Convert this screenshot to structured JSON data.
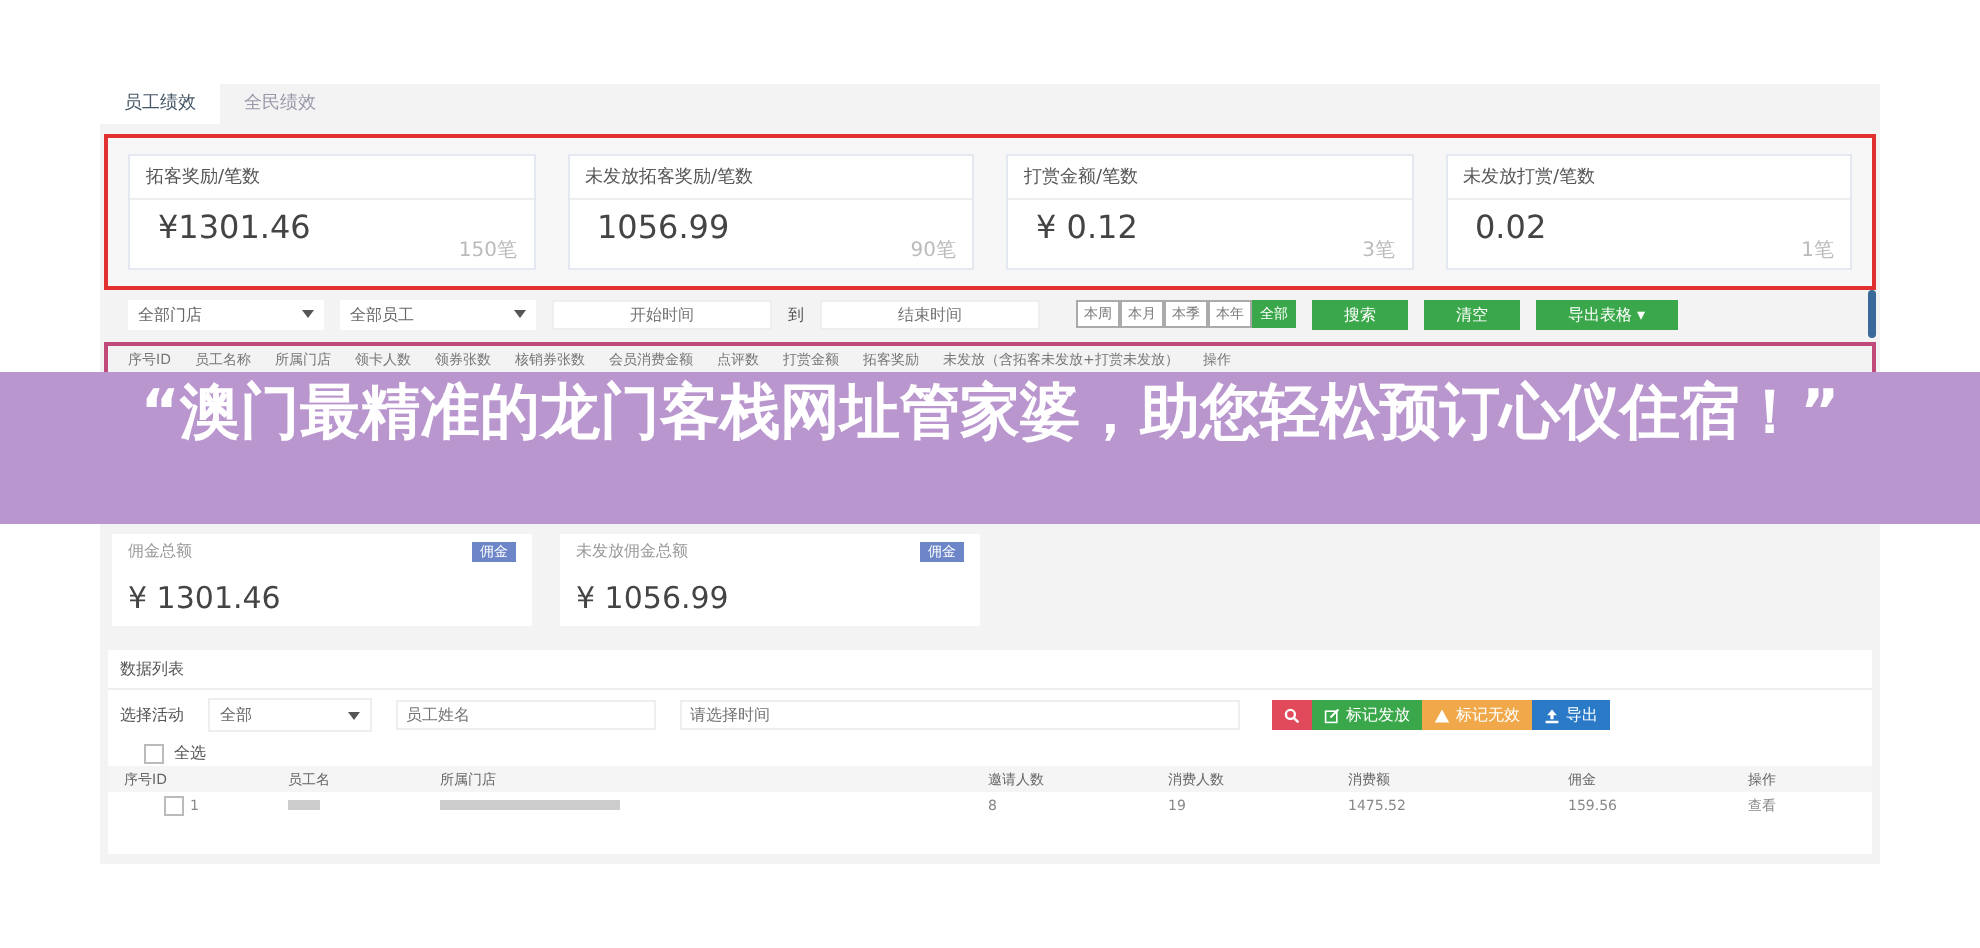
{
  "tabs": [
    {
      "label": "员工绩效",
      "selected": true
    },
    {
      "label": "全民绩效",
      "selected": false
    }
  ],
  "stat_cards": [
    {
      "label": "拓客奖励/笔数",
      "amount": "¥1301.46",
      "count": "150笔"
    },
    {
      "label": "未发放拓客奖励/笔数",
      "amount": "1056.99",
      "count": "90笔"
    },
    {
      "label": "打赏金额/笔数",
      "amount": "¥ 0.12",
      "count": "3笔"
    },
    {
      "label": "未发放打赏/笔数",
      "amount": "0.02",
      "count": "1笔"
    }
  ],
  "filters": {
    "store": "全部门店",
    "staff": "全部员工",
    "start_placeholder": "开始时间",
    "to": "到",
    "end_placeholder": "结束时间"
  },
  "periods": [
    {
      "label": "本周",
      "selected": false
    },
    {
      "label": "本月",
      "selected": false
    },
    {
      "label": "本季",
      "selected": false
    },
    {
      "label": "本年",
      "selected": false
    },
    {
      "label": "全部",
      "selected": true
    }
  ],
  "actions": [
    {
      "label": "搜索"
    },
    {
      "label": "清空"
    },
    {
      "label": "导出表格 ▾"
    }
  ],
  "old_table_columns": [
    "序号ID",
    "员工名称",
    "所属门店",
    "领卡人数",
    "领券张数",
    "核销券张数",
    "会员消费金额",
    "点评数",
    "打赏金额",
    "拓客奖励",
    "未发放（含拓客未发放+打赏未发放）",
    "操作"
  ],
  "summary_cards": [
    {
      "label": "佣金总额",
      "badge": "佣金",
      "amount": "¥ 1301.46"
    },
    {
      "label": "未发放佣金总额",
      "badge": "佣金",
      "amount": "¥ 1056.99"
    }
  ],
  "list": {
    "title": "数据列表",
    "activity_label": "选择活动",
    "activity_value": "全部",
    "name_placeholder": "员工姓名",
    "time_placeholder": "请选择时间",
    "buttons": [
      {
        "kind": "search"
      },
      {
        "kind": "mark",
        "label": "标记发放"
      },
      {
        "kind": "invalid",
        "label": "标记无效"
      },
      {
        "kind": "export",
        "label": "导出"
      }
    ],
    "select_all": {
      "label": "全选",
      "checked": false
    },
    "columns": [
      "序号ID",
      "员工名",
      "所属门店",
      "邀请人数",
      "消费人数",
      "消费额",
      "佣金",
      "操作"
    ],
    "rows": [
      {
        "checked": false,
        "id": "1",
        "invited": "8",
        "consumers": "19",
        "spend": "1475.52",
        "commission": "159.56",
        "action": "查看"
      }
    ]
  },
  "overlay_banner": "“澳门最精准的龙门客栈网址管家婆，助您轻松预订心仪住宿！”"
}
